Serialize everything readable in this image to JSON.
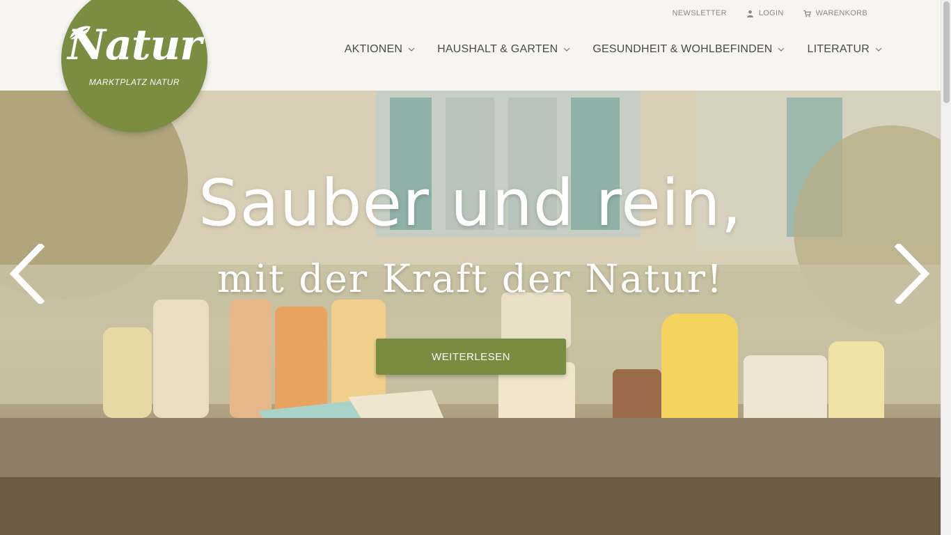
{
  "brand": {
    "logo_word": "Natur",
    "logo_sub": "MARKTPLATZ NATUR",
    "logo_color": "#7a8d41"
  },
  "topbar": {
    "items": [
      {
        "label": "NEWSLETTER",
        "icon": "none"
      },
      {
        "label": "LOGIN",
        "icon": "user-icon"
      },
      {
        "label": "WARENKORB",
        "icon": "cart-icon"
      }
    ]
  },
  "nav": {
    "items": [
      {
        "label": "AKTIONEN"
      },
      {
        "label": "HAUSHALT & GARTEN"
      },
      {
        "label": "GESUNDHEIT & WOHLBEFINDEN"
      },
      {
        "label": "LITERATUR"
      }
    ]
  },
  "hero": {
    "title": "Sauber und rein,",
    "subtitle": "mit der Kraft der Natur!",
    "cta_label": "WEITERLESEN",
    "cta_color": "#7a8c3f",
    "prev_icon": "chevron-left-icon",
    "next_icon": "chevron-right-icon"
  }
}
